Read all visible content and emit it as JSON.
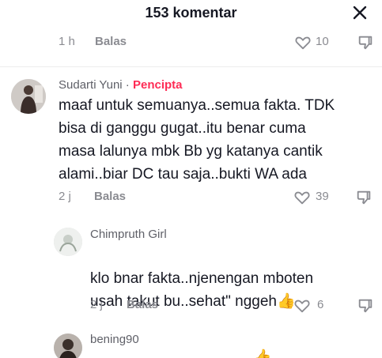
{
  "header": {
    "title": "153 komentar",
    "close_icon": "close-icon"
  },
  "top_row": {
    "time": "1 h",
    "reply_label": "Balas",
    "like_count": "10"
  },
  "comments": [
    {
      "username": "Sudarti Yuni",
      "separator": " · ",
      "badge": "Pencipta",
      "text": "maaf untuk semuanya..semua fakta. TDK\nbisa di ganggu gugat..itu benar cuma\nmasa lalunya mbk Bb yg katanya cantik\nalami..biar DC tau saja..bukti WA ada",
      "time": "2 j",
      "reply_label": "Balas",
      "like_count": "39"
    },
    {
      "username": "Chimpruth Girl",
      "text": "klo bnar fakta..njenengan mboten\nusah takut bu..sehat\" nggeh",
      "emoji": "👍",
      "time": "2 j",
      "reply_label": "Balas",
      "like_count": "6"
    },
    {
      "username": "bening90",
      "text": "",
      "emoji": "👍"
    }
  ],
  "icons": {
    "like": "heart-outline-icon",
    "dislike": "dislike-icon"
  }
}
